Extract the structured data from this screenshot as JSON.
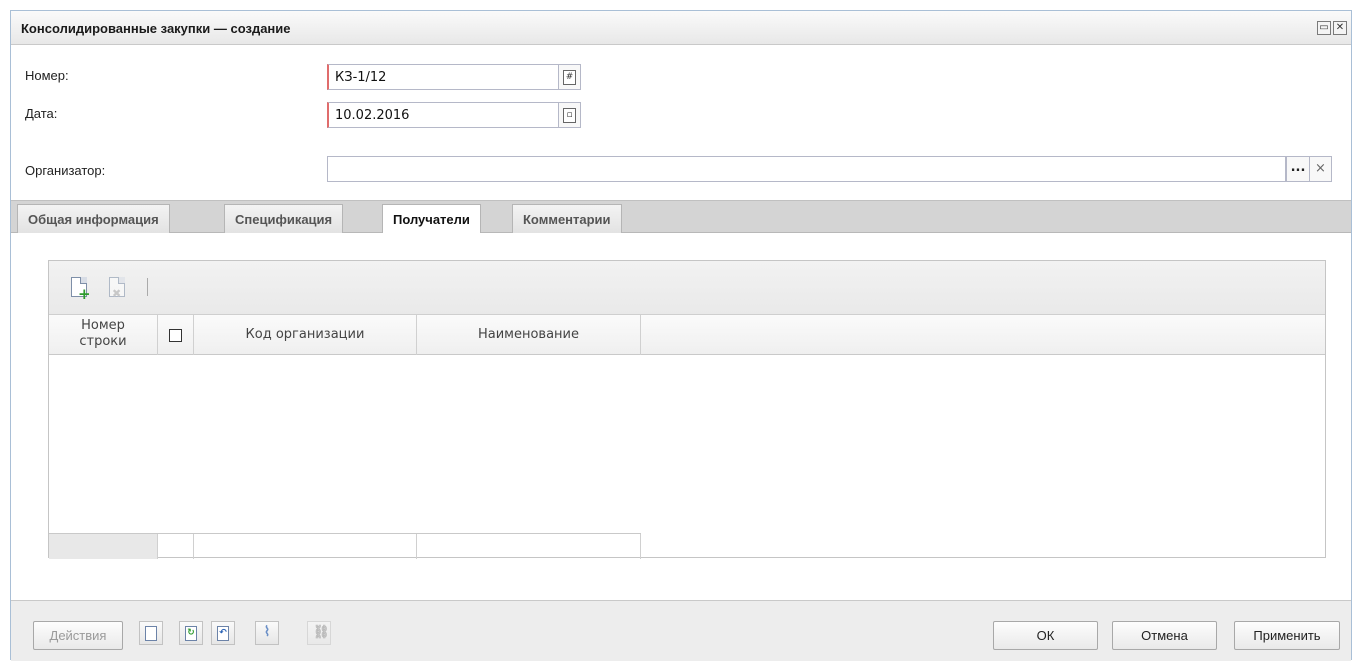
{
  "window": {
    "title": "Консолидированные закупки — создание"
  },
  "form": {
    "number_label": "Номер:",
    "number_value": "КЗ-1/12",
    "date_label": "Дата:",
    "date_value": "10.02.2016",
    "organizer_label": "Организатор:",
    "organizer_value": "",
    "organizer_dots": "...",
    "organizer_clear": "×"
  },
  "tabs": [
    {
      "label": "Общая информация",
      "active": false
    },
    {
      "label": "Спецификация",
      "active": false
    },
    {
      "label": "Получатели",
      "active": true
    },
    {
      "label": "Комментарии",
      "active": false
    }
  ],
  "grid": {
    "columns": [
      "Номер строки",
      "",
      "Код организации",
      "Наименование"
    ],
    "col_row_num_line1": "Номер",
    "col_row_num_line2": "строки",
    "rows": []
  },
  "footer": {
    "actions_label": "Действия",
    "ok_label": "ОК",
    "cancel_label": "Отмена",
    "apply_label": "Применить"
  },
  "icons": {
    "number_trigger": "hash-icon",
    "date_trigger": "calendar-icon",
    "add": "add-document-icon",
    "delete": "delete-document-icon"
  }
}
